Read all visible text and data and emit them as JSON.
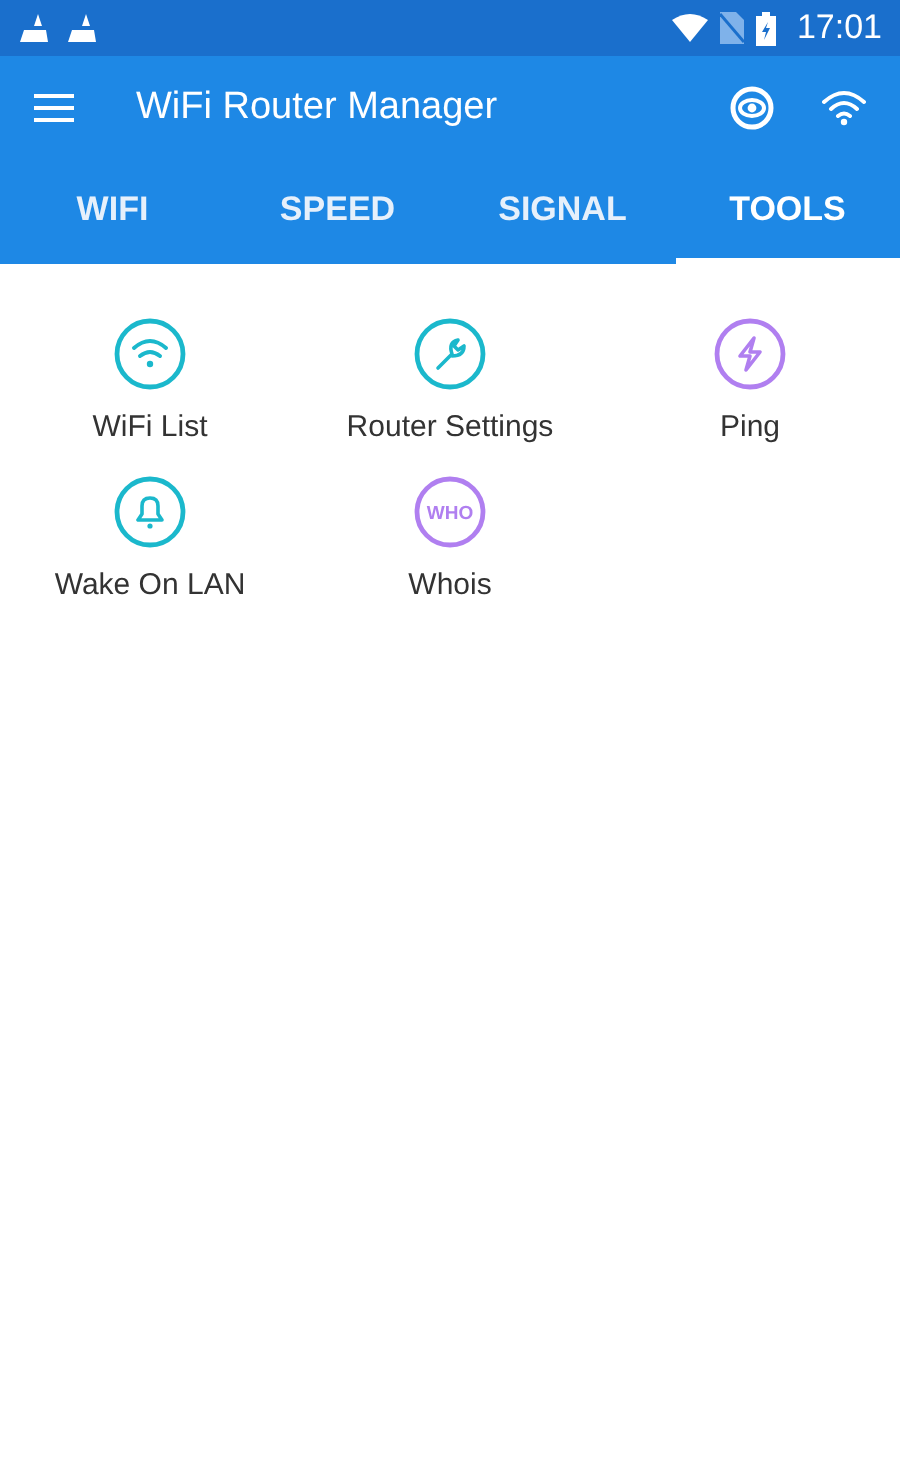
{
  "status_bar": {
    "time": "17:01"
  },
  "app_bar": {
    "title": "WiFi Router Manager"
  },
  "tabs": [
    {
      "label": "WIFI",
      "selected": false
    },
    {
      "label": "SPEED",
      "selected": false
    },
    {
      "label": "SIGNAL",
      "selected": false
    },
    {
      "label": "TOOLS",
      "selected": true
    }
  ],
  "tools": [
    {
      "label": "WiFi List",
      "kind": "wifi",
      "color": "#1bb8cc"
    },
    {
      "label": "Router Settings",
      "kind": "wrench",
      "color": "#1bb8cc"
    },
    {
      "label": "Ping",
      "kind": "bolt",
      "color": "#b07ff0"
    },
    {
      "label": "Wake On LAN",
      "kind": "bell",
      "color": "#1bb8cc"
    },
    {
      "label": "Whois",
      "kind": "text",
      "icon_text": "WHO",
      "color": "#b07ff0"
    }
  ]
}
